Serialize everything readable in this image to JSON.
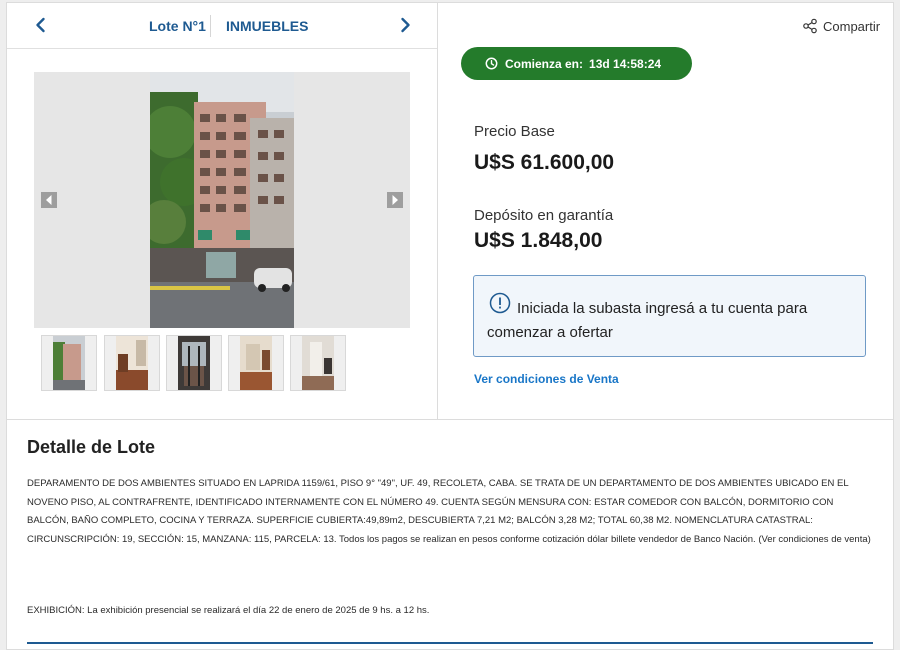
{
  "lot_nav": {
    "lot_label": "Lote N°1",
    "category_label": "INMUEBLES"
  },
  "share": {
    "label": "Compartir"
  },
  "countdown": {
    "label": "Comienza en:",
    "value": "13d 14:58:24"
  },
  "price": {
    "label": "Precio Base",
    "value": "U$S 61.600,00"
  },
  "deposit": {
    "label": "Depósito en garantía",
    "value": "U$S 1.848,00"
  },
  "notice": {
    "line1": "Iniciada la subasta ingresá a tu cuenta para",
    "line2": "comenzar a ofertar"
  },
  "conditions_link": "Ver condiciones de Venta",
  "detail": {
    "title": "Detalle de Lote",
    "description": "DEPARAMENTO DE DOS AMBIENTES SITUADO EN LAPRIDA 1159/61, PISO 9° \"49\", UF. 49, RECOLETA, CABA. SE TRATA DE UN DEPARTAMENTO DE DOS AMBIENTES UBICADO EN EL NOVENO PISO, AL CONTRAFRENTE, IDENTIFICADO INTERNAMENTE CON EL NÚMERO 49. CUENTA SEGÚN MENSURA CON: ESTAR COMEDOR CON BALCÓN, DORMITORIO CON BALCÓN, BAÑO COMPLETO, COCINA Y TERRAZA. SUPERFICIE CUBIERTA:49,89m2, DESCUBIERTA 7,21 M2; BALCÓN 3,28 M2; TOTAL 60,38 M2. NOMENCLATURA CATASTRAL: CIRCUNSCRIPCIÓN: 19, SECCIÓN: 15, MANZANA: 115, PARCELA: 13. Todos los pagos se realizan en pesos conforme cotización dólar billete vendedor de Banco Nación. (Ver condiciones de venta)",
    "exhibition": "EXHIBICIÓN: La exhibición presencial se realizará el día 22 de enero de 2025 de 9 hs. a 12 hs."
  },
  "colors": {
    "brand_blue": "#1e5a91",
    "link_blue": "#1976c7",
    "countdown_green": "#247b2b"
  },
  "icons": {
    "prev": "chevron-left-icon",
    "next": "chevron-right-icon",
    "share": "share-icon",
    "clock": "clock-icon",
    "info": "info-icon"
  }
}
